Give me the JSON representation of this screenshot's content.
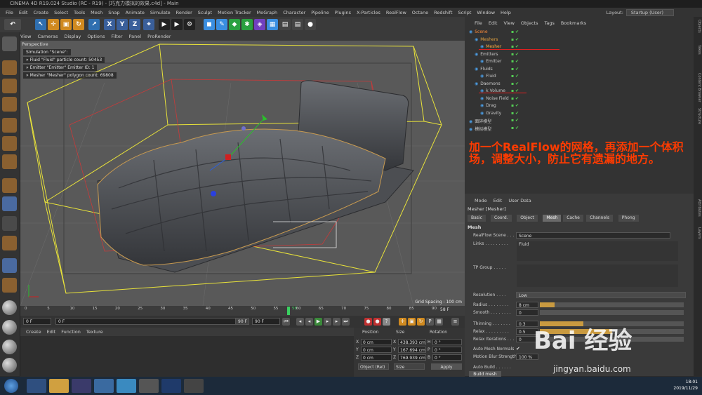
{
  "window": {
    "title": "CINEMA 4D R19.024 Studio (RC - R19) - [巧克力模拟的效果.c4d] - Main"
  },
  "menubar": {
    "items": [
      "File",
      "Edit",
      "Create",
      "Select",
      "Tools",
      "Mesh",
      "Snap",
      "Animate",
      "Simulate",
      "Render",
      "Sculpt",
      "Motion Tracker",
      "MoGraph",
      "Character",
      "Pipeline",
      "Plugins",
      "X-Particles",
      "RealFlow",
      "Octane",
      "Redshift",
      "Script",
      "Window",
      "Help"
    ]
  },
  "layout": {
    "label": "Layout:",
    "value": "Startup (User)"
  },
  "toolbar": {
    "x": "X",
    "y": "Y",
    "z": "Z"
  },
  "viewport": {
    "menu": [
      "View",
      "Cameras",
      "Display",
      "Options",
      "Filter",
      "Panel",
      "ProRender"
    ],
    "label": "Perspective",
    "hud": [
      "Simulation \"Scene\":",
      "» Fluid \"Fluid\" particle count: 50453",
      "» Emitter \"Emitter\" Emitter ID: 1",
      "» Mesher \"Mesher\" polygon count: 69808"
    ],
    "grid_spacing": "Grid Spacing : 100 cm"
  },
  "timeline": {
    "ticks": [
      "0",
      "5",
      "10",
      "15",
      "20",
      "25",
      "30",
      "35",
      "40",
      "45",
      "50",
      "55",
      "60",
      "65",
      "70",
      "75",
      "80",
      "85",
      "90"
    ],
    "current_frame": "58",
    "current_label": "58 F"
  },
  "transport": {
    "start": "0 F",
    "cur": "0 F",
    "end": "90 F",
    "end2": "90 F"
  },
  "material": {
    "menu": [
      "Create",
      "Edit",
      "Function",
      "Texture"
    ]
  },
  "coords": {
    "headers": [
      "Position",
      "Size",
      "Rotation"
    ],
    "rows": [
      {
        "axis": "X",
        "pos": "0 cm",
        "size": "438.393 cm",
        "rlabel": "H",
        "rot": "0 °"
      },
      {
        "axis": "Y",
        "pos": "0 cm",
        "size": "167.694 cm",
        "rlabel": "P",
        "rot": "0 °"
      },
      {
        "axis": "Z",
        "pos": "0 cm",
        "size": "769.939 cm",
        "rlabel": "B",
        "rot": "0 °"
      }
    ],
    "mode": "Object (Rel)",
    "size_mode": "Size",
    "apply": "Apply"
  },
  "objects": {
    "menu": [
      "File",
      "Edit",
      "View",
      "Objects",
      "Tags",
      "Bookmarks"
    ],
    "items": [
      {
        "label": "Scene",
        "indent": 0,
        "color": "#ff8c3a"
      },
      {
        "label": "Meshers",
        "indent": 1,
        "color": "#e0a040"
      },
      {
        "label": "Mesher",
        "indent": 2,
        "color": "#ffb040"
      },
      {
        "label": "Emitters",
        "indent": 1,
        "color": "#c8c8c8"
      },
      {
        "label": "Emitter",
        "indent": 2,
        "color": "#c8c8c8"
      },
      {
        "label": "Fluids",
        "indent": 1,
        "color": "#c8c8c8"
      },
      {
        "label": "Fluid",
        "indent": 2,
        "color": "#c8c8c8"
      },
      {
        "label": "Daemons",
        "indent": 1,
        "color": "#c8c8c8"
      },
      {
        "label": "k Volume",
        "indent": 2,
        "color": "#c8c8c8"
      },
      {
        "label": "Noise Field",
        "indent": 2,
        "color": "#c8c8c8"
      },
      {
        "label": "Drag",
        "indent": 2,
        "color": "#c8c8c8"
      },
      {
        "label": "Gravity",
        "indent": 2,
        "color": "#c8c8c8"
      },
      {
        "label": "面碎模型",
        "indent": 0,
        "color": "#c8c8c8"
      },
      {
        "label": "模拟模型",
        "indent": 0,
        "color": "#c8c8c8"
      }
    ]
  },
  "sidetabs": [
    "Objects",
    "Takes",
    "Content Browser",
    "Structure",
    "Attributes",
    "Layers"
  ],
  "annotation": "加一个RealFlow的网格，再添加一个体积场，调整大小，防止它有遗漏的地方。",
  "attributes": {
    "menu": [
      "Mode",
      "Edit",
      "User Data"
    ],
    "object_title": "Mesher [Mesher]",
    "tabs": [
      "Basic",
      "Coord.",
      "Object",
      "Mesh",
      "Cache",
      "Channels",
      "Phong"
    ],
    "active_tab": "Mesh",
    "section": "Mesh",
    "realflow_scene_label": "RealFlow Scene . . .",
    "realflow_scene_value": "Scene",
    "links_label": "Links . . . . . . . . .",
    "links_value": "Fluid",
    "tp_group_label": "TP Group . . . . .",
    "resolution_label": "Resolution . . . .",
    "resolution_value": "Low",
    "params": [
      {
        "label": "Radius . . . . . . . .",
        "value": "8 cm",
        "fill": 0.1
      },
      {
        "label": "Smooth . . . . . . . .",
        "value": "0",
        "fill": 0
      },
      {
        "label": "Thinning . . . . . . .",
        "value": "0.3",
        "fill": 0.3
      },
      {
        "label": "Relax . . . . . . . . .",
        "value": "0.5",
        "fill": 0.5
      },
      {
        "label": "Relax Iterations . . .",
        "value": "0",
        "fill": 0
      }
    ],
    "auto_normals_label": "Auto Mesh Normals",
    "auto_normals_value": "✔",
    "motion_blur_label": "Motion Blur Strength",
    "motion_blur_value": "100 %",
    "auto_build_label": "Auto Build . . . . . .",
    "build_mesh": "Build mesh"
  },
  "watermark": {
    "brand": "Bai  经验",
    "url": "jingyan.baidu.com"
  },
  "taskbar": {
    "time": "18:01",
    "date": "2019/11/29"
  }
}
